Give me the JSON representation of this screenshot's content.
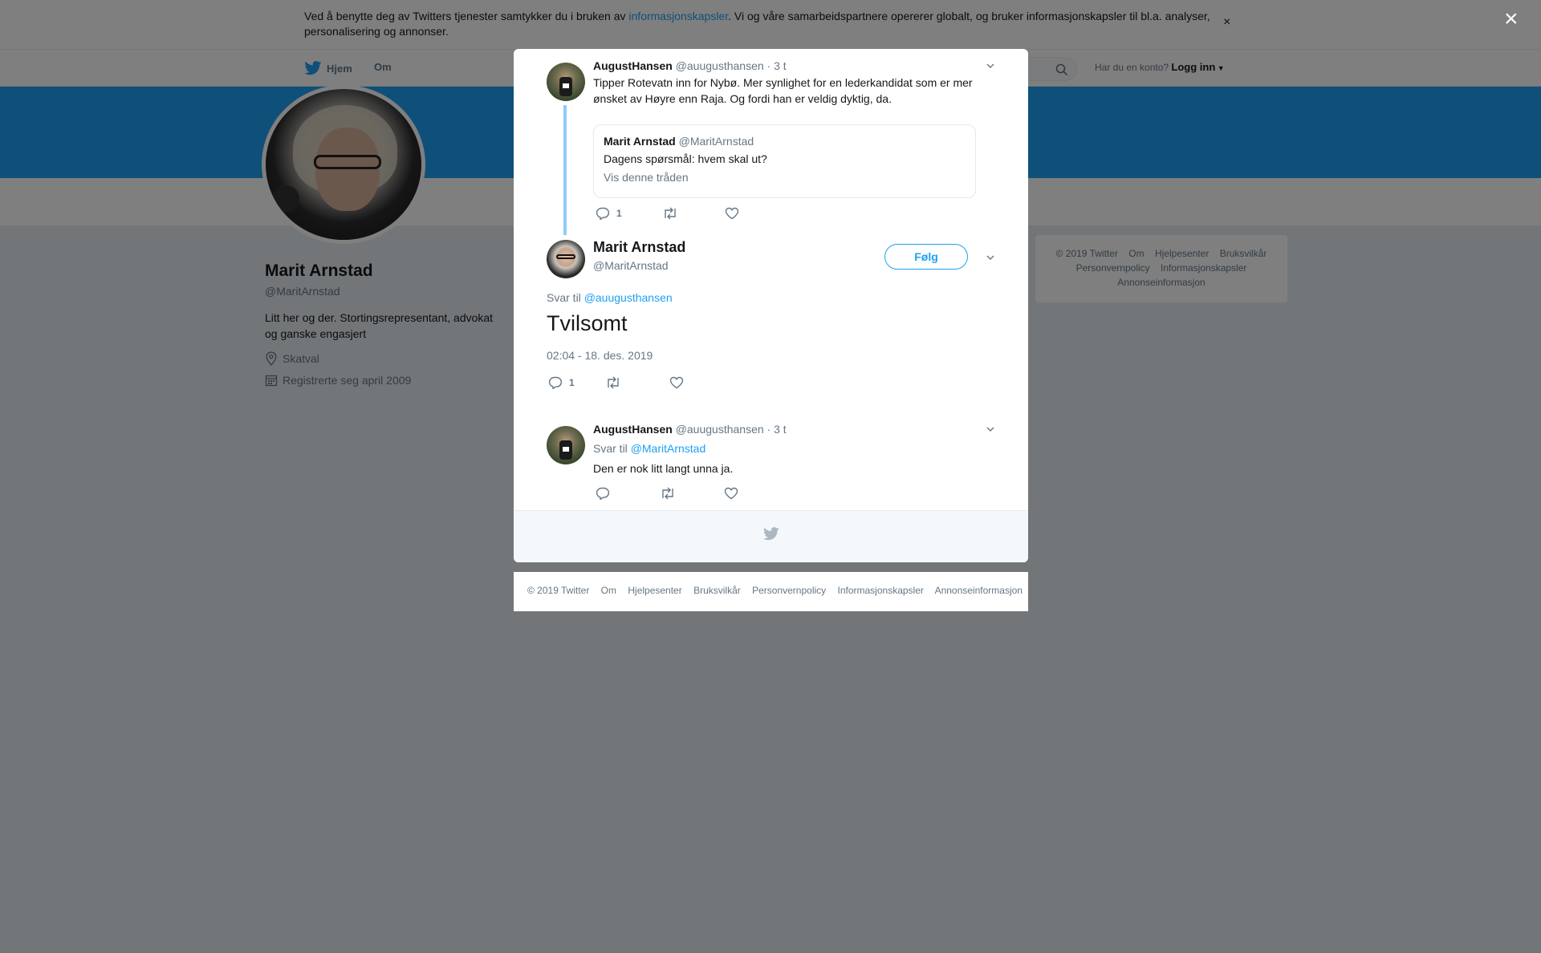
{
  "cookie_banner": {
    "text_before": "Ved å benytte deg av Twitters tjenester samtykker du i bruken av ",
    "link": "informasjonskapsler",
    "text_after": ". Vi og våre samarbeidspartnere opererer globalt, og bruker informasjonskapsler til bl.a. analyser, personalisering og annonser.",
    "close": "×"
  },
  "nav": {
    "home": "Hjem",
    "about": "Om",
    "login_prompt": "Har du en konto?",
    "login": "Logg inn"
  },
  "profile": {
    "name": "Marit Arnstad",
    "handle": "@MaritArnstad",
    "bio": "Litt her og der. Stortingsrepresentant, advokat og ganske engasjert",
    "location": "Skatval",
    "joined": "Registrerte seg april 2009"
  },
  "sidebar_footer": [
    "© 2019 Twitter",
    "Om",
    "Hjelpesenter",
    "Bruksvilkår",
    "Personvernpolicy",
    "Informasjonskapsler",
    "Annonseinformasjon"
  ],
  "modal_close": "×",
  "tweets": {
    "parent": {
      "name": "AugustHansen",
      "handle": "@auugusthansen",
      "time": "· 3 t",
      "text": "Tipper Rotevatn inn for Nybø. Mer synlighet for en lederkandidat som er mer ønsket av Høyre enn Raja. Og fordi han er veldig dyktig, da.",
      "quote": {
        "name": "Marit Arnstad",
        "handle": "@MaritArnstad",
        "text": "Dagens spørsmål: hvem skal ut?",
        "link": "Vis denne tråden"
      },
      "reply_count": "1"
    },
    "main": {
      "name": "Marit Arnstad",
      "handle": "@MaritArnstad",
      "follow": "Følg",
      "reply_prefix": "Svar til ",
      "reply_to": "@auugusthansen",
      "text": "Tvilsomt",
      "timestamp": "02:04 - 18. des. 2019",
      "reply_count": "1"
    },
    "reply": {
      "name": "AugustHansen",
      "handle": "@auugusthansen",
      "time": "· 3 t",
      "reply_prefix": "Svar til ",
      "reply_to": "@MaritArnstad",
      "text": "Den er nok litt langt unna ja."
    }
  },
  "bottom_footer": [
    "© 2019 Twitter",
    "Om",
    "Hjelpesenter",
    "Bruksvilkår",
    "Personvernpolicy",
    "Informasjonskapsler",
    "Annonseinformasjon"
  ],
  "colors": {
    "accent": "#1da1f2",
    "overlay": "rgba(0,0,0,0.5)",
    "secondary_text": "#657786"
  }
}
